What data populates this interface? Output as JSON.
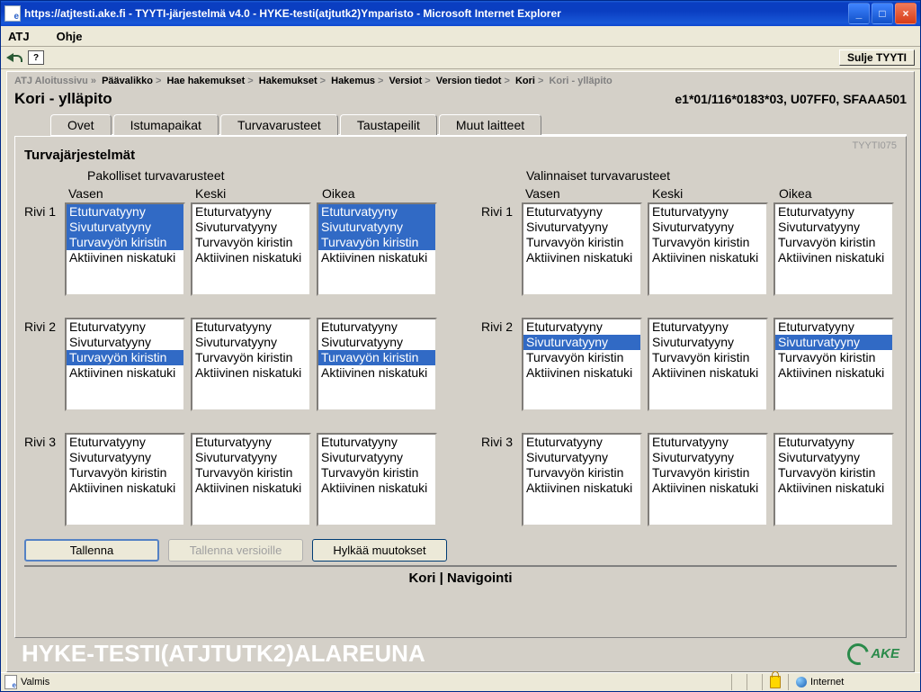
{
  "window": {
    "title": "https://atjtesti.ake.fi - TYYTI-järjestelmä v4.0 - HYKE-testi(atjtutk2)Ymparisto - Microsoft Internet Explorer"
  },
  "menu": {
    "item1": "ATJ",
    "item2": "Ohje"
  },
  "toolbar": {
    "help": "?",
    "close": "Sulje TYYTI"
  },
  "breadcrumbs": {
    "items": [
      "ATJ Aloitussivu",
      "Päävalikko",
      "Hae hakemukset",
      "Hakemukset",
      "Hakemus",
      "Versiot",
      "Version tiedot",
      "Kori",
      "Kori - ylläpito"
    ]
  },
  "page": {
    "title": "Kori - ylläpito",
    "code": "e1*01/116*0183*03, U07FF0, SFAAA501"
  },
  "tabs": {
    "t0": "Ovet",
    "t1": "Istumapaikat",
    "t2": "Turvavarusteet",
    "t3": "Taustapeilit",
    "t4": "Muut laitteet",
    "active": 2
  },
  "panel": {
    "id": "TYYTI075",
    "section": "Turvajärjestelmät",
    "group_left": "Pakolliset turvavarusteet",
    "group_right": "Valinnaiset turvavarusteet",
    "cols": {
      "c0": "Vasen",
      "c1": "Keski",
      "c2": "Oikea"
    },
    "rows": {
      "r0": "Rivi 1",
      "r1": "Rivi 2",
      "r2": "Rivi 3"
    },
    "options": {
      "o0": "Etuturvatyyny",
      "o1": "Sivuturvatyyny",
      "o2": "Turvavyön kiristin",
      "o3": "Aktiivinen niskatuki"
    }
  },
  "buttons": {
    "save": "Tallenna",
    "save_versions": "Tallenna versioille",
    "discard": "Hylkää muutokset"
  },
  "nav_line": "Kori | Navigointi",
  "env_label": "HYKE-TESTI(ATJTUTK2)ALAREUNA",
  "ake": "AKE",
  "status": {
    "ready": "Valmis",
    "zone": "Internet"
  }
}
